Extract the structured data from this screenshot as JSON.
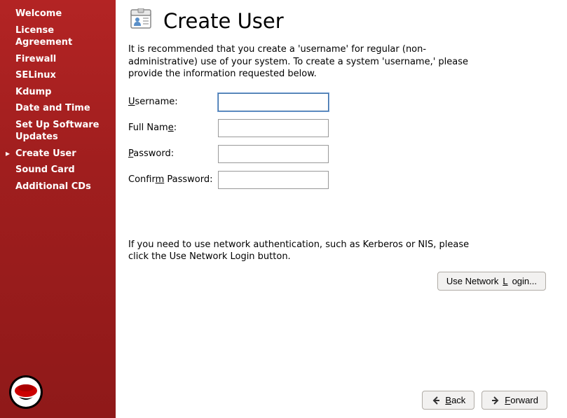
{
  "sidebar": {
    "items": [
      {
        "label": "Welcome",
        "active": false
      },
      {
        "label": "License Agreement",
        "active": false
      },
      {
        "label": "Firewall",
        "active": false
      },
      {
        "label": "SELinux",
        "active": false
      },
      {
        "label": "Kdump",
        "active": false
      },
      {
        "label": "Date and Time",
        "active": false
      },
      {
        "label": "Set Up Software Updates",
        "active": false
      },
      {
        "label": "Create User",
        "active": true
      },
      {
        "label": "Sound Card",
        "active": false
      },
      {
        "label": "Additional CDs",
        "active": false
      }
    ]
  },
  "header": {
    "title": "Create User"
  },
  "intro": "It is recommended that you create a 'username' for regular (non-administrative) use of your system. To create a system 'username,' please provide the information requested below.",
  "form": {
    "username": {
      "label_pre": "U",
      "label_rest": "sername:",
      "value": ""
    },
    "fullname": {
      "label_pre": "Full Nam",
      "label_u": "e",
      "label_rest": ":",
      "value": ""
    },
    "password": {
      "label_pre": "P",
      "label_rest": "assword:",
      "value": ""
    },
    "confirm": {
      "label_pre": "Confir",
      "label_u": "m",
      "label_rest": " Password:",
      "value": ""
    }
  },
  "note": "If you need to use network authentication, such as Kerberos or NIS, please click the Use Network Login button.",
  "buttons": {
    "network_login_pre": "Use Network ",
    "network_login_u": "L",
    "network_login_rest": "ogin...",
    "back_u": "B",
    "back_rest": "ack",
    "forward_u": "F",
    "forward_rest": "orward"
  }
}
